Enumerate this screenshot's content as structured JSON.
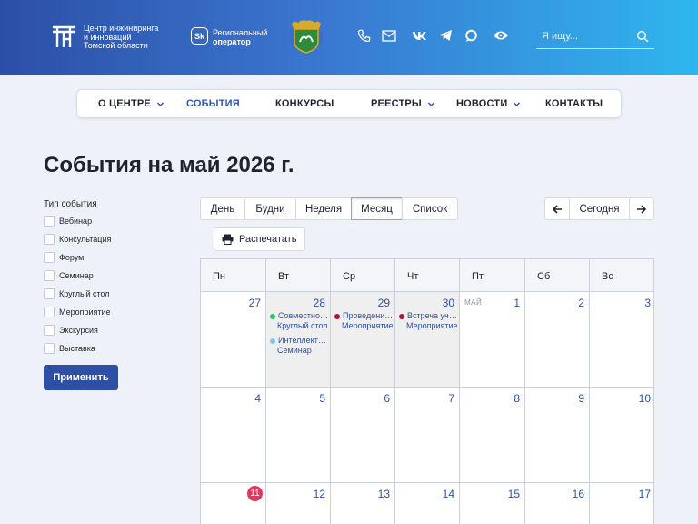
{
  "header": {
    "logo_lines": [
      "Центр инжиниринга",
      "и инноваций",
      "Томской области"
    ],
    "operator_badge": "Sk",
    "operator_lines": [
      "Региональный",
      "оператор"
    ],
    "icons": [
      "phone-icon",
      "mail-icon",
      "vk-icon",
      "telegram-icon",
      "chat-icon",
      "eye-icon"
    ],
    "search_placeholder": "Я ищу..."
  },
  "nav": {
    "items": [
      {
        "label": "О ЦЕНТРЕ",
        "has_dropdown": true,
        "active": false
      },
      {
        "label": "СОБЫТИЯ",
        "has_dropdown": false,
        "active": true
      },
      {
        "label": "КОНКУРСЫ",
        "has_dropdown": false,
        "active": false
      },
      {
        "label": "РЕЕСТРЫ",
        "has_dropdown": true,
        "active": false
      },
      {
        "label": "НОВОСТИ",
        "has_dropdown": true,
        "active": false
      },
      {
        "label": "КОНТАКТЫ",
        "has_dropdown": false,
        "active": false
      }
    ]
  },
  "page": {
    "title": "События на май 2026 г."
  },
  "filter": {
    "title": "Тип события",
    "options": [
      "Вебинар",
      "Консультация",
      "Форум",
      "Семинар",
      "Круглый стол",
      "Мероприятие",
      "Экскурсия",
      "Выставка"
    ],
    "apply_label": "Применить"
  },
  "views": {
    "buttons": [
      "День",
      "Будни",
      "Неделя",
      "Месяц",
      "Список"
    ],
    "active": "Месяц",
    "today_label": "Сегодня",
    "print_label": "Распечатать"
  },
  "calendar": {
    "weekdays": [
      "Пн",
      "Вт",
      "Ср",
      "Чт",
      "Пт",
      "Сб",
      "Вс"
    ],
    "weeks": [
      [
        {
          "day": "27",
          "other": false,
          "events": []
        },
        {
          "day": "28",
          "other": true,
          "events": [
            {
              "title": "Совместное…",
              "type": "Круглый стол",
              "color": "#22c55e"
            },
            {
              "title": "Интеллекту…",
              "type": "Семинар",
              "color": "#7cc8f0"
            }
          ]
        },
        {
          "day": "29",
          "other": true,
          "events": [
            {
              "title": "Проведени…",
              "type": "Мероприятие",
              "color": "#b0123a"
            }
          ]
        },
        {
          "day": "30",
          "other": true,
          "events": [
            {
              "title": "Встреча уча…",
              "type": "Мероприятие",
              "color": "#b0123a"
            }
          ]
        },
        {
          "day": "1",
          "other": false,
          "month": "МАЙ",
          "events": []
        },
        {
          "day": "2",
          "other": false,
          "events": []
        },
        {
          "day": "3",
          "other": false,
          "events": []
        }
      ],
      [
        {
          "day": "4",
          "other": false,
          "events": []
        },
        {
          "day": "5",
          "other": false,
          "events": []
        },
        {
          "day": "6",
          "other": false,
          "events": []
        },
        {
          "day": "7",
          "other": false,
          "events": []
        },
        {
          "day": "8",
          "other": false,
          "events": []
        },
        {
          "day": "9",
          "other": false,
          "events": []
        },
        {
          "day": "10",
          "other": false,
          "events": []
        }
      ],
      [
        {
          "day": "11",
          "other": false,
          "today": true,
          "events": []
        },
        {
          "day": "12",
          "other": false,
          "events": []
        },
        {
          "day": "13",
          "other": false,
          "events": []
        },
        {
          "day": "14",
          "other": false,
          "events": []
        },
        {
          "day": "15",
          "other": false,
          "events": []
        },
        {
          "day": "16",
          "other": false,
          "events": []
        },
        {
          "day": "17",
          "other": false,
          "events": []
        }
      ]
    ]
  }
}
